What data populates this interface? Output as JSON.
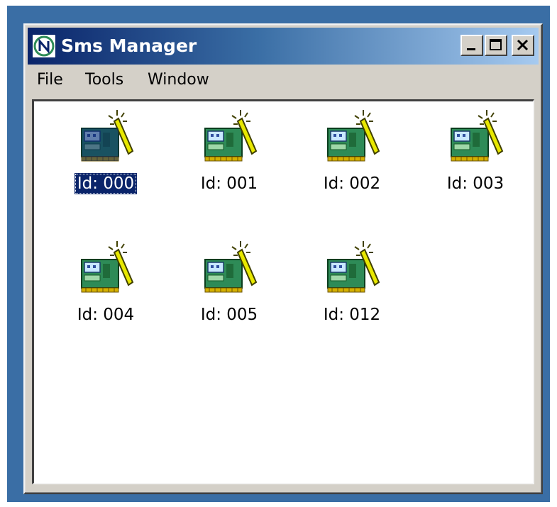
{
  "window": {
    "title": "Sms Manager",
    "icon": "app-logo-icon",
    "controls": {
      "minimize_icon": "minimize-icon",
      "maximize_icon": "maximize-icon",
      "close_icon": "close-icon"
    }
  },
  "menu": {
    "items": [
      "File",
      "Tools",
      "Window"
    ]
  },
  "devices": [
    {
      "label": "Id: 000",
      "selected": true
    },
    {
      "label": "Id: 001",
      "selected": false
    },
    {
      "label": "Id: 002",
      "selected": false
    },
    {
      "label": "Id: 003",
      "selected": false
    },
    {
      "label": "Id: 004",
      "selected": false
    },
    {
      "label": "Id: 005",
      "selected": false
    },
    {
      "label": "Id: 012",
      "selected": false
    }
  ],
  "colors": {
    "desktop": "#3a6ea5",
    "title_gradient_start": "#0a246a",
    "title_gradient_end": "#a6caf0",
    "window_face": "#d4d0c8",
    "selection": "#0a246a",
    "board_green": "#2e8b57",
    "wand_yellow": "#e8e800"
  }
}
